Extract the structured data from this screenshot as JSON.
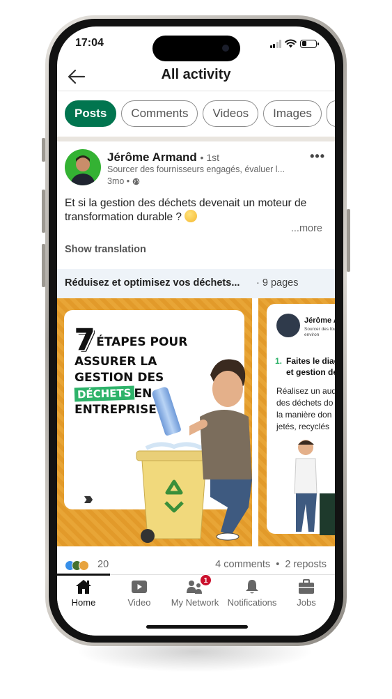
{
  "status": {
    "time": "17:04"
  },
  "header": {
    "title": "All activity"
  },
  "filters": {
    "chips": [
      "Posts",
      "Comments",
      "Videos",
      "Images"
    ],
    "active": "Posts"
  },
  "post": {
    "author": "Jérôme Armand",
    "degree": "• 1st",
    "headline": "Sourcer des fournisseurs engagés, évaluer l...",
    "age": "3mo •",
    "text": "Et si la gestion des déchets devenait un moteur de transformation durable ?",
    "see_more": "...more",
    "show_translation": "Show translation",
    "document": {
      "title": "Réduisez et optimisez vos déchets...",
      "pages": "· 9 pages"
    },
    "slide1": {
      "number": "7",
      "line1": "ÉTAPES POUR",
      "line2": "ASSURER LA",
      "line3": "GESTION DES",
      "tag": "DÉCHETS",
      "line4_end": "EN",
      "line5": "ENTREPRISE"
    },
    "slide2": {
      "name": "Jérôme Ar",
      "subtitle": "Sourcer des fourni social et environ",
      "step_number": "1.",
      "step_line1": "Faites le diag",
      "step_line2": "et gestion de",
      "body": [
        "Réalisez un aud",
        "des déchets do",
        "la manière don",
        "jetés, recyclés"
      ]
    },
    "reactions": {
      "count": "20",
      "colors": [
        "#378fe9",
        "#44712e",
        "#e7a33e"
      ]
    },
    "comments": "4 comments",
    "separator": "•",
    "reposts": "2 reposts"
  },
  "tabbar": {
    "items": [
      {
        "label": "Home",
        "icon": "home-icon",
        "active": true
      },
      {
        "label": "Video",
        "icon": "video-icon"
      },
      {
        "label": "My Network",
        "icon": "network-icon",
        "badge": "1"
      },
      {
        "label": "Notifications",
        "icon": "bell-icon"
      },
      {
        "label": "Jobs",
        "icon": "briefcase-icon"
      }
    ]
  },
  "colors": {
    "accent": "#01754f",
    "badge": "#cb112d",
    "slide_bg": "#e8a536",
    "tag_green": "#2eb36a"
  }
}
